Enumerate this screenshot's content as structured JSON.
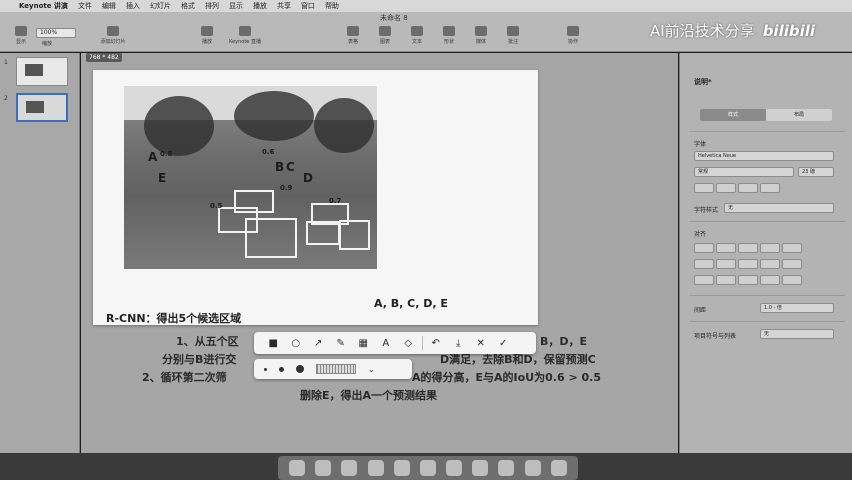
{
  "menubar": {
    "apple_symbol": "",
    "app_name": "Keynote 讲演",
    "items": [
      "文件",
      "编辑",
      "插入",
      "幻灯片",
      "格式",
      "排列",
      "显示",
      "播放",
      "共享",
      "窗口",
      "帮助"
    ],
    "document_title": "未命名 8"
  },
  "toolbar": {
    "zoom_value": "100%",
    "zoom_label": "缩放",
    "buttons": [
      {
        "label": "显示"
      },
      {
        "label": "添加幻灯片"
      },
      {
        "label": "播放"
      },
      {
        "label": "Keynote 直播"
      },
      {
        "label": "表格"
      },
      {
        "label": "图表"
      },
      {
        "label": "文本"
      },
      {
        "label": "形状"
      },
      {
        "label": "媒体"
      },
      {
        "label": "批注"
      },
      {
        "label": "协作"
      },
      {
        "label": "格式"
      },
      {
        "label": "动画效果"
      },
      {
        "label": "文稿"
      }
    ]
  },
  "watermark": {
    "text": "AI前沿技术分享",
    "logo": "bilibili"
  },
  "navigator": {
    "slides": [
      {
        "num": "1"
      },
      {
        "num": "2"
      }
    ]
  },
  "canvas": {
    "size_badge": "768 * 482"
  },
  "slide": {
    "boxes_caption": "A, B, C, D, E",
    "rcnn_caption": "R-CNN：得出5个候选区域",
    "labels": [
      {
        "letter": "A",
        "score": "0.8"
      },
      {
        "letter": "B",
        "score": "0.6"
      },
      {
        "letter": "C",
        "score": "0.9"
      },
      {
        "letter": "D",
        "score": "0.7"
      },
      {
        "letter": "E",
        "score": "0.5"
      }
    ]
  },
  "lower_text": {
    "line1": "1、从五个区",
    "line1_tail": "B，D，E",
    "line2": "分别与B进行交",
    "line2_tail": "D满足，去除B和D，保留预测C",
    "line3": "2、循环第二次筛",
    "line3_tail": "A的得分高，E与A的IoU为0.6 > 0.5",
    "line4": "删除E，得出A一个预测结果"
  },
  "annotation_toolbar": {
    "tools": [
      "filled-rect-icon",
      "ellipse-icon",
      "arrow-icon",
      "pen-icon",
      "mosaic-icon",
      "text-icon",
      "eraser-icon",
      "undo-icon",
      "download-icon",
      "close-icon",
      "check-icon"
    ],
    "glyphs": [
      "■",
      "○",
      "↗",
      "✎",
      "▦",
      "A",
      "◇",
      "↶",
      "⤓",
      "✕",
      "✓"
    ]
  },
  "annotation_subbar": {
    "chevron": "⌄"
  },
  "inspector": {
    "style_title": "说明*",
    "segments": [
      "样式",
      "布局"
    ],
    "font_section": "字体",
    "font_name": "Helvetica Neue",
    "font_style": "常规",
    "font_size": "23 磅",
    "char_style_label": "字符样式",
    "char_style_value": "无",
    "align_section": "对齐",
    "spacing_label": "间距",
    "spacing_value": "1.0 - 倍",
    "bullets_label": "项目符号与列表",
    "bullets_value": "无"
  },
  "colors": {
    "box_outline": "#f2f2f2",
    "menubar": "#d8d8d8",
    "toolbar": "#b9b9b9",
    "canvas": "#a6a6a6",
    "inspector": "#b3b3b3",
    "slide_bg": "#f6f6f6"
  }
}
